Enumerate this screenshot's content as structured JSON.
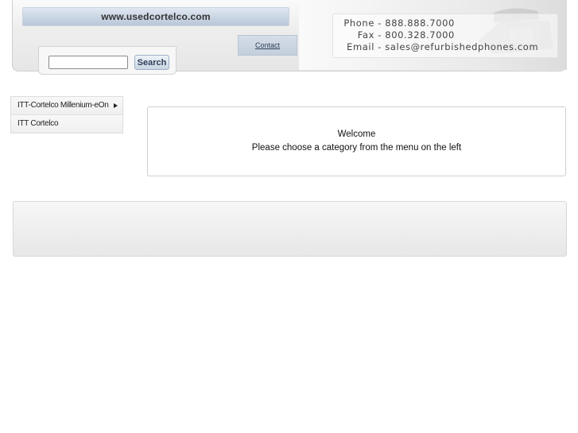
{
  "header": {
    "site_url": "www.usedcortelco.com",
    "nav": {
      "contact_label": "Contact"
    },
    "search": {
      "value": "",
      "placeholder": "",
      "button_label": "Search"
    },
    "contact_info": [
      {
        "label": "Phone",
        "value": "888.888.7000"
      },
      {
        "label": "Fax",
        "value": "800.328.7000"
      },
      {
        "label": "Email",
        "value": "sales@refurbishedphones.com"
      }
    ]
  },
  "sidebar": {
    "items": [
      {
        "label": "ITT-Cortelco Millenium-eOn",
        "has_submenu": true,
        "icon": "arrow-right-icon"
      },
      {
        "label": "ITT Cortelco",
        "has_submenu": false
      }
    ]
  },
  "main": {
    "welcome_title": "Welcome",
    "welcome_message": "Please choose a category from the menu on the left"
  }
}
